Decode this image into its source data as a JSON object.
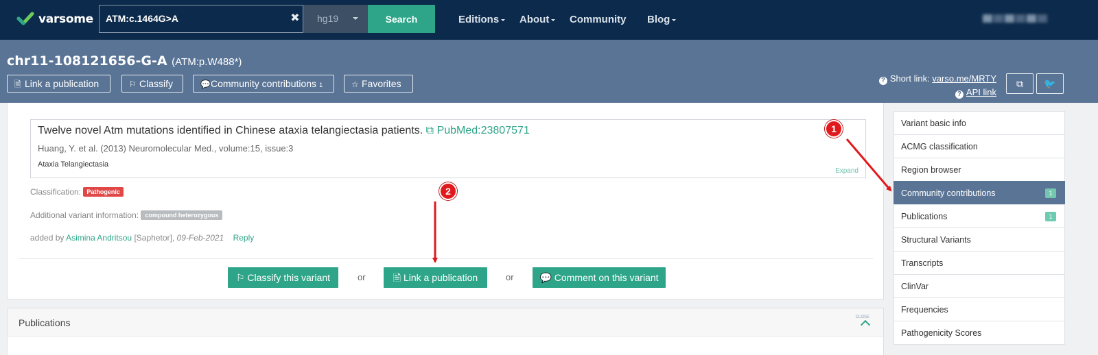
{
  "topbar": {
    "logo_text": "varsome",
    "search_value": "ATM:c.1464G>A",
    "assembly": "hg19",
    "search_label": "Search",
    "nav": [
      {
        "label": "Editions",
        "has_caret": true
      },
      {
        "label": "About",
        "has_caret": true
      },
      {
        "label": "Community",
        "has_caret": false
      },
      {
        "label": "Blog",
        "has_caret": true
      }
    ]
  },
  "variant": {
    "title": "chr11-108121656-G-A",
    "protein": "(ATM:p.W488*)",
    "actions": {
      "link_publication": "Link a publication",
      "classify": "Classify",
      "community": "Community contributions",
      "community_count": "1",
      "favorites": "Favorites"
    },
    "short_link_label": "Short link:",
    "short_link": "varso.me/MRTY",
    "api_link": "API link"
  },
  "contribution": {
    "pub_title": "Twelve novel Atm mutations identified in Chinese ataxia telangiectasia patients.",
    "pub_link": "PubMed:23807571",
    "pub_authors": "Huang, Y. et al. (2013) Neuromolecular Med., volume:15, issue:3",
    "pub_disease": "Ataxia Telangiectasia",
    "expand": "Expand",
    "classification_label": "Classification:",
    "classification_value": "Pathogenic",
    "additional_label": "Additional variant information:",
    "additional_value": "compound heterozygous",
    "added_by_prefix": "added by",
    "added_by_name": "Asimina Andritsou",
    "added_by_org": "[Saphetor],",
    "added_date": "09-Feb-2021",
    "reply": "Reply",
    "btn_classify": "Classify this variant",
    "btn_link": "Link a publication",
    "btn_comment": "Comment on this variant",
    "or": "or"
  },
  "publications_section": {
    "title": "Publications",
    "close": "CLOSE"
  },
  "sidebar": {
    "items": [
      {
        "label": "Variant basic info",
        "count": "",
        "active": false
      },
      {
        "label": "ACMG classification",
        "count": "",
        "active": false
      },
      {
        "label": "Region browser",
        "count": "",
        "active": false
      },
      {
        "label": "Community contributions",
        "count": "1",
        "active": true
      },
      {
        "label": "Publications",
        "count": "1",
        "active": false
      },
      {
        "label": "Structural Variants",
        "count": "",
        "active": false
      },
      {
        "label": "Transcripts",
        "count": "",
        "active": false
      },
      {
        "label": "ClinVar",
        "count": "",
        "active": false
      },
      {
        "label": "Frequencies",
        "count": "",
        "active": false
      },
      {
        "label": "Pathogenicity Scores",
        "count": "",
        "active": false
      }
    ]
  },
  "annotations": {
    "marker_1": "1",
    "marker_2": "2",
    "color": "#e0191c"
  },
  "colors": {
    "navy": "#0c2a4b",
    "slate": "#5a7495",
    "teal": "#2ea588",
    "pathogenic": "#e04848"
  }
}
